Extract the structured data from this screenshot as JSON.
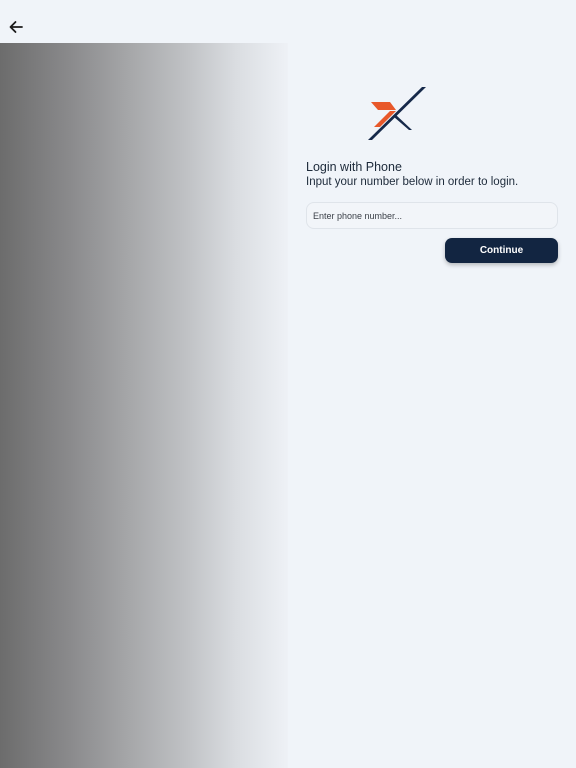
{
  "header": {
    "back_icon": "arrow-left-icon"
  },
  "logo": {
    "icon": "x-logo-icon",
    "colors": {
      "orange": "#e8582a",
      "navy": "#16294a"
    }
  },
  "login": {
    "title": "Login with Phone",
    "subtitle": "Input your number below in order to login.",
    "phone_placeholder": "Enter phone number...",
    "continue_label": "Continue"
  },
  "theme": {
    "background": "#f0f4f9",
    "button": "#122541",
    "text": "#1d2a3a"
  }
}
